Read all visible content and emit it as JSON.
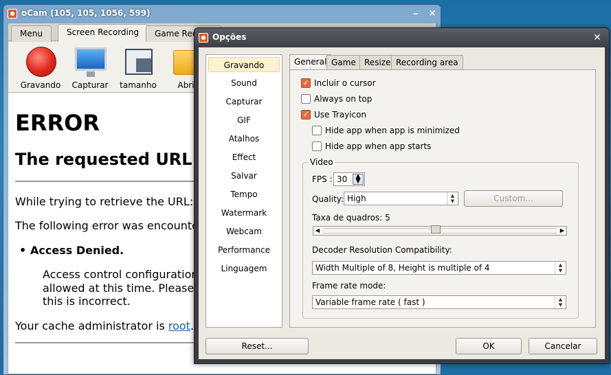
{
  "ocam": {
    "title": "oCam (105, 105, 1056, 599)",
    "tabs": [
      {
        "label": "Menu"
      },
      {
        "label": "Screen Recording"
      },
      {
        "label": "Game Reco"
      }
    ],
    "tools": [
      {
        "label": "Gravando",
        "icon": "record-icon"
      },
      {
        "label": "Capturar",
        "icon": "monitor-icon"
      },
      {
        "label": "tamanho",
        "icon": "resize-icon"
      },
      {
        "label": "Abrir",
        "icon": "folder-icon"
      }
    ],
    "browser": {
      "h1": "ERROR",
      "h2": "The requested URL",
      "p1": "While trying to retrieve the URL:",
      "p2": "The following error was encounte",
      "bullet": "Access Denied.",
      "indent_l1": "Access control configuration",
      "indent_l2": "allowed at this time. Please",
      "indent_l3": "this is incorrect.",
      "admin_prefix": "Your cache administrator is ",
      "admin_link": "root",
      "admin_suffix": "."
    }
  },
  "dialog": {
    "title": "Opções",
    "nav": [
      "Gravando",
      "Sound",
      "Capturar",
      "GIF",
      "Atalhos",
      "Effect",
      "Salvar",
      "Tempo",
      "Watermark",
      "Webcam",
      "Performance",
      "Linguagem"
    ],
    "tabs": [
      "General",
      "Game",
      "Resize",
      "Recording area"
    ],
    "general": {
      "include_cursor": {
        "label": "Incluir o cursor",
        "checked": true
      },
      "always_on_top": {
        "label": "Always on top",
        "checked": false
      },
      "use_trayicon": {
        "label": "Use Trayicon",
        "checked": true
      },
      "hide_minimized": {
        "label": "Hide app when app is minimized",
        "checked": false
      },
      "hide_starts": {
        "label": "Hide app when app starts",
        "checked": false
      }
    },
    "video": {
      "group_label": "Video",
      "fps_label": "FPS :",
      "fps_value": "30",
      "quality_label": "Quality:",
      "quality_value": "High",
      "custom_button": "Custom...",
      "frame_rate_label": "Taxa de quadros: 5",
      "frame_rate_slider": 0.48,
      "decoder_label": "Decoder Resolution Compatibility:",
      "decoder_value": "Width Multiple of 8, Height is multiple of 4",
      "frame_mode_label": "Frame rate mode:",
      "frame_mode_value": "Variable frame rate ( fast )"
    },
    "buttons": {
      "reset": "Reset...",
      "ok": "OK",
      "cancel": "Cancelar"
    }
  },
  "colors": {
    "checked": "#e56a3f",
    "nav_selected": "#fdf2cf",
    "link": "#1a5fa8"
  }
}
